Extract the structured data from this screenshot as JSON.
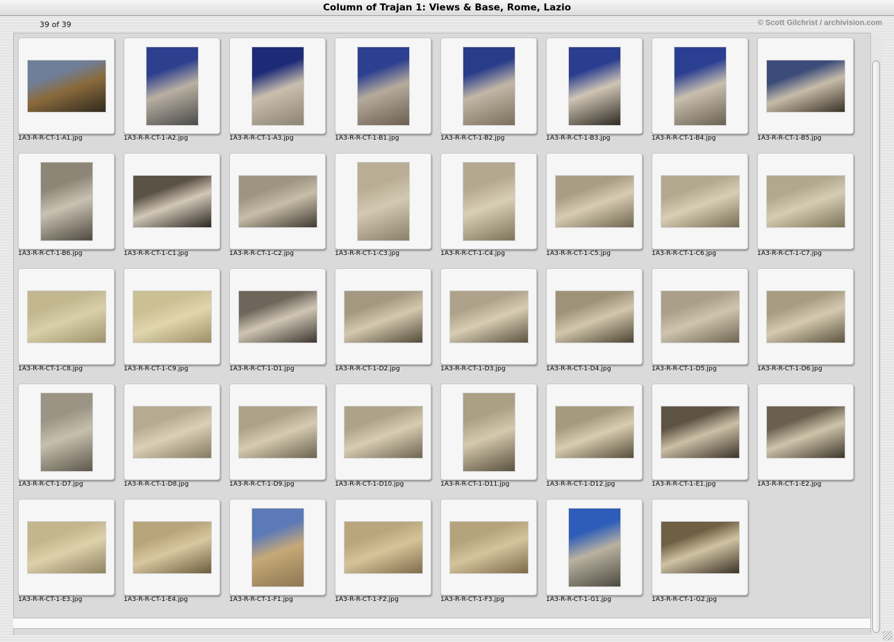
{
  "window": {
    "title": "Column of Trajan 1: Views & Base, Rome, Lazio"
  },
  "header": {
    "count": "39 of 39",
    "credit": "© Scott Gilchrist / archivision.com"
  },
  "thumbnails": [
    {
      "file": "1A3-R-R-CT-1-A1.jpg",
      "orient": "landscape",
      "palette": [
        "#6f7f99",
        "#8a6a3c",
        "#2f2a1e"
      ]
    },
    {
      "file": "1A3-R-R-CT-1-A2.jpg",
      "orient": "portrait",
      "palette": [
        "#2d3f8e",
        "#b9b0a2",
        "#4a4a4a"
      ]
    },
    {
      "file": "1A3-R-R-CT-1-A3.jpg",
      "orient": "portrait",
      "palette": [
        "#1d2a76",
        "#c9bfae",
        "#8c8373"
      ]
    },
    {
      "file": "1A3-R-R-CT-1-B1.jpg",
      "orient": "portrait",
      "palette": [
        "#2c3f90",
        "#b5ab9c",
        "#6b5f4f"
      ]
    },
    {
      "file": "1A3-R-R-CT-1-B2.jpg",
      "orient": "portrait",
      "palette": [
        "#283c8a",
        "#c2b7a6",
        "#7a6e5c"
      ]
    },
    {
      "file": "1A3-R-R-CT-1-B3.jpg",
      "orient": "portrait",
      "palette": [
        "#2a3d8e",
        "#cfc5b4",
        "#2e2a22"
      ]
    },
    {
      "file": "1A3-R-R-CT-1-B4.jpg",
      "orient": "portrait",
      "palette": [
        "#2b3f92",
        "#c8bfae",
        "#6a6152"
      ]
    },
    {
      "file": "1A3-R-R-CT-1-B5.jpg",
      "orient": "landscape",
      "palette": [
        "#3b4b7a",
        "#c6bca8",
        "#3a3228"
      ]
    },
    {
      "file": "1A3-R-R-CT-1-B6.jpg",
      "orient": "portrait",
      "palette": [
        "#8d8576",
        "#c9c1b1",
        "#4f4a40"
      ]
    },
    {
      "file": "1A3-R-R-CT-1-C1.jpg",
      "orient": "landscape",
      "palette": [
        "#5b5246",
        "#d1c8b7",
        "#2a2620"
      ]
    },
    {
      "file": "1A3-R-R-CT-1-C2.jpg",
      "orient": "landscape",
      "palette": [
        "#9d9482",
        "#c7bda9",
        "#403a30"
      ]
    },
    {
      "file": "1A3-R-R-CT-1-C3.jpg",
      "orient": "portrait",
      "palette": [
        "#b9ae95",
        "#d3c9b2",
        "#8a8069"
      ]
    },
    {
      "file": "1A3-R-R-CT-1-C4.jpg",
      "orient": "portrait",
      "palette": [
        "#b4a98e",
        "#d9cfb6",
        "#7e7459"
      ]
    },
    {
      "file": "1A3-R-R-CT-1-C5.jpg",
      "orient": "landscape",
      "palette": [
        "#a99e85",
        "#d7ccb2",
        "#6f664f"
      ]
    },
    {
      "file": "1A3-R-R-CT-1-C6.jpg",
      "orient": "landscape",
      "palette": [
        "#b3a98f",
        "#d8ceb4",
        "#776d55"
      ]
    },
    {
      "file": "1A3-R-R-CT-1-C7.jpg",
      "orient": "landscape",
      "palette": [
        "#b2a88d",
        "#d6ccb2",
        "#7c7258"
      ]
    },
    {
      "file": "1A3-R-R-CT-1-C8.jpg",
      "orient": "landscape",
      "palette": [
        "#c2b78f",
        "#d9cfa8",
        "#9d926c"
      ]
    },
    {
      "file": "1A3-R-R-CT-1-C9.jpg",
      "orient": "landscape",
      "palette": [
        "#cbbf94",
        "#e0d5ad",
        "#9c9068"
      ]
    },
    {
      "file": "1A3-R-R-CT-1-D1.jpg",
      "orient": "landscape",
      "palette": [
        "#6e665a",
        "#cfc6b5",
        "#3c362e"
      ]
    },
    {
      "file": "1A3-R-R-CT-1-D2.jpg",
      "orient": "landscape",
      "palette": [
        "#a49980",
        "#d4c9ae",
        "#524a3a"
      ]
    },
    {
      "file": "1A3-R-R-CT-1-D3.jpg",
      "orient": "landscape",
      "palette": [
        "#aea38a",
        "#d8cdb3",
        "#5b5240"
      ]
    },
    {
      "file": "1A3-R-R-CT-1-D4.jpg",
      "orient": "landscape",
      "palette": [
        "#9e9379",
        "#d2c7ac",
        "#4c4433"
      ]
    },
    {
      "file": "1A3-R-R-CT-1-D5.jpg",
      "orient": "landscape",
      "palette": [
        "#aaa089",
        "#cfc5ae",
        "#6e6552"
      ]
    },
    {
      "file": "1A3-R-R-CT-1-D6.jpg",
      "orient": "landscape",
      "palette": [
        "#a89d82",
        "#d5caaf",
        "#5d5441"
      ]
    },
    {
      "file": "1A3-R-R-CT-1-D7.jpg",
      "orient": "portrait",
      "palette": [
        "#9b9383",
        "#c6bfae",
        "#5e584b"
      ]
    },
    {
      "file": "1A3-R-R-CT-1-D8.jpg",
      "orient": "landscape",
      "palette": [
        "#b6ab91",
        "#dbd0b6",
        "#847a61"
      ]
    },
    {
      "file": "1A3-R-R-CT-1-D9.jpg",
      "orient": "landscape",
      "palette": [
        "#ada287",
        "#d6cbb0",
        "#6b6250"
      ]
    },
    {
      "file": "1A3-R-R-CT-1-D10.jpg",
      "orient": "landscape",
      "palette": [
        "#aea388",
        "#d8cdb2",
        "#6e6552"
      ]
    },
    {
      "file": "1A3-R-R-CT-1-D11.jpg",
      "orient": "portrait",
      "palette": [
        "#ab9f84",
        "#d4c9ad",
        "#5a513f"
      ]
    },
    {
      "file": "1A3-R-R-CT-1-D12.jpg",
      "orient": "landscape",
      "palette": [
        "#a69a7d",
        "#d8cdb0",
        "#564d3b"
      ]
    },
    {
      "file": "1A3-R-R-CT-1-E1.jpg",
      "orient": "landscape",
      "palette": [
        "#5d5344",
        "#cbbfa6",
        "#3a3328"
      ]
    },
    {
      "file": "1A3-R-R-CT-1-E2.jpg",
      "orient": "landscape",
      "palette": [
        "#6a604f",
        "#cfc4ab",
        "#3c352a"
      ]
    },
    {
      "file": "1A3-R-R-CT-1-E3.jpg",
      "orient": "landscape",
      "palette": [
        "#c3b58c",
        "#ddd1aa",
        "#8e8262"
      ]
    },
    {
      "file": "1A3-R-R-CT-1-E4.jpg",
      "orient": "landscape",
      "palette": [
        "#b8a47a",
        "#d8c79f",
        "#6c5d3f"
      ]
    },
    {
      "file": "1A3-R-R-CT-1-F1.jpg",
      "orient": "portrait",
      "palette": [
        "#5c79b8",
        "#c6a978",
        "#8e7652"
      ]
    },
    {
      "file": "1A3-R-R-CT-1-F2.jpg",
      "orient": "landscape",
      "palette": [
        "#b9a67d",
        "#d6c399",
        "#7f6d4b"
      ]
    },
    {
      "file": "1A3-R-R-CT-1-F3.jpg",
      "orient": "landscape",
      "palette": [
        "#b5a37c",
        "#d5c39c",
        "#7c6b4a"
      ]
    },
    {
      "file": "1A3-R-R-CT-1-G1.jpg",
      "orient": "portrait",
      "palette": [
        "#2d5db8",
        "#b9b2a0",
        "#4d4a40"
      ]
    },
    {
      "file": "1A3-R-R-CT-1-G2.jpg",
      "orient": "landscape",
      "palette": [
        "#6f5f43",
        "#d0c3a3",
        "#3b3226"
      ]
    }
  ]
}
